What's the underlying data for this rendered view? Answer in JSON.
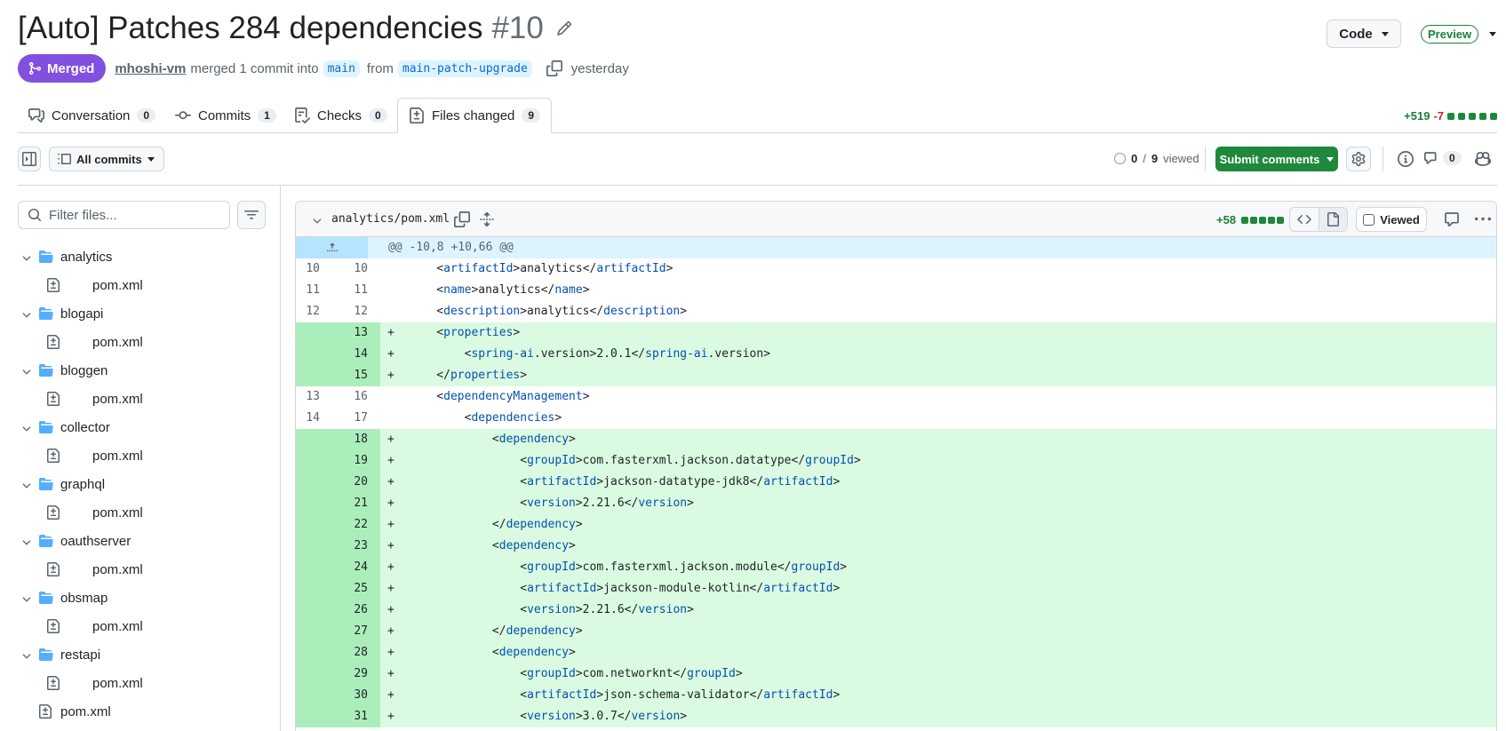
{
  "header": {
    "title": "[Auto] Patches 284 dependencies",
    "number": "#10",
    "code_button": "Code",
    "preview_badge": "Preview"
  },
  "meta": {
    "status": "Merged",
    "user": "mhoshi-vm",
    "merged_text": "merged 1 commit into",
    "base_branch": "main",
    "from_text": "from",
    "head_branch": "main-patch-upgrade",
    "time": "yesterday"
  },
  "tabs": [
    {
      "label": "Conversation",
      "count": "0"
    },
    {
      "label": "Commits",
      "count": "1"
    },
    {
      "label": "Checks",
      "count": "0"
    },
    {
      "label": "Files changed",
      "count": "9"
    }
  ],
  "diffstat": {
    "additions": "+519",
    "deletions": "-7"
  },
  "toolbar": {
    "all_commits": "All commits",
    "viewed_num": "0",
    "viewed_total": "9",
    "viewed_label": "viewed",
    "viewed_sep": "/",
    "submit": "Submit comments",
    "comments_count": "0"
  },
  "filter": {
    "placeholder": "Filter files..."
  },
  "tree": {
    "dirs": [
      {
        "name": "analytics",
        "file": "pom.xml"
      },
      {
        "name": "blogapi",
        "file": "pom.xml"
      },
      {
        "name": "bloggen",
        "file": "pom.xml"
      },
      {
        "name": "collector",
        "file": "pom.xml"
      },
      {
        "name": "graphql",
        "file": "pom.xml"
      },
      {
        "name": "oauthserver",
        "file": "pom.xml"
      },
      {
        "name": "obsmap",
        "file": "pom.xml"
      },
      {
        "name": "restapi",
        "file": "pom.xml"
      }
    ],
    "root_file": "pom.xml"
  },
  "diff": {
    "filename": "analytics/pom.xml",
    "additions": "+58",
    "viewed_label": "Viewed",
    "hunk": "@@ -10,8 +10,66 @@",
    "lines": [
      {
        "o": "10",
        "n": "10",
        "t": "ctx",
        "code": "    <artifactId>analytics</artifactId>"
      },
      {
        "o": "11",
        "n": "11",
        "t": "ctx",
        "code": "    <name>analytics</name>"
      },
      {
        "o": "12",
        "n": "12",
        "t": "ctx",
        "code": "    <description>analytics</description>"
      },
      {
        "o": "",
        "n": "13",
        "t": "add",
        "code": "    <properties>"
      },
      {
        "o": "",
        "n": "14",
        "t": "add",
        "code": "        <spring-ai.version>2.0.1</spring-ai.version>"
      },
      {
        "o": "",
        "n": "15",
        "t": "add",
        "code": "    </properties>"
      },
      {
        "o": "13",
        "n": "16",
        "t": "ctx",
        "code": "    <dependencyManagement>"
      },
      {
        "o": "14",
        "n": "17",
        "t": "ctx",
        "code": "        <dependencies>"
      },
      {
        "o": "",
        "n": "18",
        "t": "add",
        "code": "            <dependency>"
      },
      {
        "o": "",
        "n": "19",
        "t": "add",
        "code": "                <groupId>com.fasterxml.jackson.datatype</groupId>"
      },
      {
        "o": "",
        "n": "20",
        "t": "add",
        "code": "                <artifactId>jackson-datatype-jdk8</artifactId>"
      },
      {
        "o": "",
        "n": "21",
        "t": "add",
        "code": "                <version>2.21.6</version>"
      },
      {
        "o": "",
        "n": "22",
        "t": "add",
        "code": "            </dependency>"
      },
      {
        "o": "",
        "n": "23",
        "t": "add",
        "code": "            <dependency>"
      },
      {
        "o": "",
        "n": "24",
        "t": "add",
        "code": "                <groupId>com.fasterxml.jackson.module</groupId>"
      },
      {
        "o": "",
        "n": "25",
        "t": "add",
        "code": "                <artifactId>jackson-module-kotlin</artifactId>"
      },
      {
        "o": "",
        "n": "26",
        "t": "add",
        "code": "                <version>2.21.6</version>"
      },
      {
        "o": "",
        "n": "27",
        "t": "add",
        "code": "            </dependency>"
      },
      {
        "o": "",
        "n": "28",
        "t": "add",
        "code": "            <dependency>"
      },
      {
        "o": "",
        "n": "29",
        "t": "add",
        "code": "                <groupId>com.networknt</groupId>"
      },
      {
        "o": "",
        "n": "30",
        "t": "add",
        "code": "                <artifactId>json-schema-validator</artifactId>"
      },
      {
        "o": "",
        "n": "31",
        "t": "add",
        "code": "                <version>3.0.7</version>"
      }
    ]
  },
  "colors": {
    "merged": "#8250df",
    "addition": "#1a7f37",
    "deletion": "#cf222e",
    "add_bg": "#dafbe1",
    "add_gutter": "#aceebb",
    "hunk_bg": "#ddf4ff",
    "tag": "#0550ae",
    "submit": "#1f883d",
    "folder": "#54aeff"
  }
}
